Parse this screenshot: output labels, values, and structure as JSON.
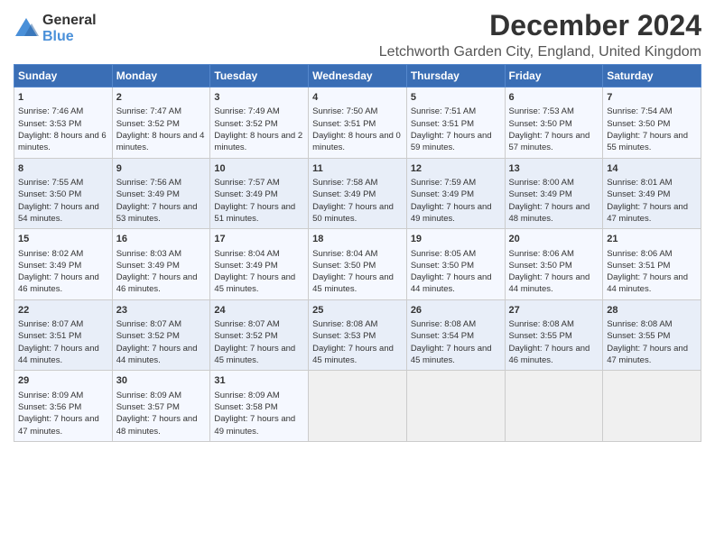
{
  "logo": {
    "general": "General",
    "blue": "Blue"
  },
  "title": "December 2024",
  "subtitle": "Letchworth Garden City, England, United Kingdom",
  "days_header": [
    "Sunday",
    "Monday",
    "Tuesday",
    "Wednesday",
    "Thursday",
    "Friday",
    "Saturday"
  ],
  "weeks": [
    [
      {
        "day": "1",
        "sunrise": "Sunrise: 7:46 AM",
        "sunset": "Sunset: 3:53 PM",
        "daylight": "Daylight: 8 hours and 6 minutes."
      },
      {
        "day": "2",
        "sunrise": "Sunrise: 7:47 AM",
        "sunset": "Sunset: 3:52 PM",
        "daylight": "Daylight: 8 hours and 4 minutes."
      },
      {
        "day": "3",
        "sunrise": "Sunrise: 7:49 AM",
        "sunset": "Sunset: 3:52 PM",
        "daylight": "Daylight: 8 hours and 2 minutes."
      },
      {
        "day": "4",
        "sunrise": "Sunrise: 7:50 AM",
        "sunset": "Sunset: 3:51 PM",
        "daylight": "Daylight: 8 hours and 0 minutes."
      },
      {
        "day": "5",
        "sunrise": "Sunrise: 7:51 AM",
        "sunset": "Sunset: 3:51 PM",
        "daylight": "Daylight: 7 hours and 59 minutes."
      },
      {
        "day": "6",
        "sunrise": "Sunrise: 7:53 AM",
        "sunset": "Sunset: 3:50 PM",
        "daylight": "Daylight: 7 hours and 57 minutes."
      },
      {
        "day": "7",
        "sunrise": "Sunrise: 7:54 AM",
        "sunset": "Sunset: 3:50 PM",
        "daylight": "Daylight: 7 hours and 55 minutes."
      }
    ],
    [
      {
        "day": "8",
        "sunrise": "Sunrise: 7:55 AM",
        "sunset": "Sunset: 3:50 PM",
        "daylight": "Daylight: 7 hours and 54 minutes."
      },
      {
        "day": "9",
        "sunrise": "Sunrise: 7:56 AM",
        "sunset": "Sunset: 3:49 PM",
        "daylight": "Daylight: 7 hours and 53 minutes."
      },
      {
        "day": "10",
        "sunrise": "Sunrise: 7:57 AM",
        "sunset": "Sunset: 3:49 PM",
        "daylight": "Daylight: 7 hours and 51 minutes."
      },
      {
        "day": "11",
        "sunrise": "Sunrise: 7:58 AM",
        "sunset": "Sunset: 3:49 PM",
        "daylight": "Daylight: 7 hours and 50 minutes."
      },
      {
        "day": "12",
        "sunrise": "Sunrise: 7:59 AM",
        "sunset": "Sunset: 3:49 PM",
        "daylight": "Daylight: 7 hours and 49 minutes."
      },
      {
        "day": "13",
        "sunrise": "Sunrise: 8:00 AM",
        "sunset": "Sunset: 3:49 PM",
        "daylight": "Daylight: 7 hours and 48 minutes."
      },
      {
        "day": "14",
        "sunrise": "Sunrise: 8:01 AM",
        "sunset": "Sunset: 3:49 PM",
        "daylight": "Daylight: 7 hours and 47 minutes."
      }
    ],
    [
      {
        "day": "15",
        "sunrise": "Sunrise: 8:02 AM",
        "sunset": "Sunset: 3:49 PM",
        "daylight": "Daylight: 7 hours and 46 minutes."
      },
      {
        "day": "16",
        "sunrise": "Sunrise: 8:03 AM",
        "sunset": "Sunset: 3:49 PM",
        "daylight": "Daylight: 7 hours and 46 minutes."
      },
      {
        "day": "17",
        "sunrise": "Sunrise: 8:04 AM",
        "sunset": "Sunset: 3:49 PM",
        "daylight": "Daylight: 7 hours and 45 minutes."
      },
      {
        "day": "18",
        "sunrise": "Sunrise: 8:04 AM",
        "sunset": "Sunset: 3:50 PM",
        "daylight": "Daylight: 7 hours and 45 minutes."
      },
      {
        "day": "19",
        "sunrise": "Sunrise: 8:05 AM",
        "sunset": "Sunset: 3:50 PM",
        "daylight": "Daylight: 7 hours and 44 minutes."
      },
      {
        "day": "20",
        "sunrise": "Sunrise: 8:06 AM",
        "sunset": "Sunset: 3:50 PM",
        "daylight": "Daylight: 7 hours and 44 minutes."
      },
      {
        "day": "21",
        "sunrise": "Sunrise: 8:06 AM",
        "sunset": "Sunset: 3:51 PM",
        "daylight": "Daylight: 7 hours and 44 minutes."
      }
    ],
    [
      {
        "day": "22",
        "sunrise": "Sunrise: 8:07 AM",
        "sunset": "Sunset: 3:51 PM",
        "daylight": "Daylight: 7 hours and 44 minutes."
      },
      {
        "day": "23",
        "sunrise": "Sunrise: 8:07 AM",
        "sunset": "Sunset: 3:52 PM",
        "daylight": "Daylight: 7 hours and 44 minutes."
      },
      {
        "day": "24",
        "sunrise": "Sunrise: 8:07 AM",
        "sunset": "Sunset: 3:52 PM",
        "daylight": "Daylight: 7 hours and 45 minutes."
      },
      {
        "day": "25",
        "sunrise": "Sunrise: 8:08 AM",
        "sunset": "Sunset: 3:53 PM",
        "daylight": "Daylight: 7 hours and 45 minutes."
      },
      {
        "day": "26",
        "sunrise": "Sunrise: 8:08 AM",
        "sunset": "Sunset: 3:54 PM",
        "daylight": "Daylight: 7 hours and 45 minutes."
      },
      {
        "day": "27",
        "sunrise": "Sunrise: 8:08 AM",
        "sunset": "Sunset: 3:55 PM",
        "daylight": "Daylight: 7 hours and 46 minutes."
      },
      {
        "day": "28",
        "sunrise": "Sunrise: 8:08 AM",
        "sunset": "Sunset: 3:55 PM",
        "daylight": "Daylight: 7 hours and 47 minutes."
      }
    ],
    [
      {
        "day": "29",
        "sunrise": "Sunrise: 8:09 AM",
        "sunset": "Sunset: 3:56 PM",
        "daylight": "Daylight: 7 hours and 47 minutes."
      },
      {
        "day": "30",
        "sunrise": "Sunrise: 8:09 AM",
        "sunset": "Sunset: 3:57 PM",
        "daylight": "Daylight: 7 hours and 48 minutes."
      },
      {
        "day": "31",
        "sunrise": "Sunrise: 8:09 AM",
        "sunset": "Sunset: 3:58 PM",
        "daylight": "Daylight: 7 hours and 49 minutes."
      },
      null,
      null,
      null,
      null
    ]
  ]
}
